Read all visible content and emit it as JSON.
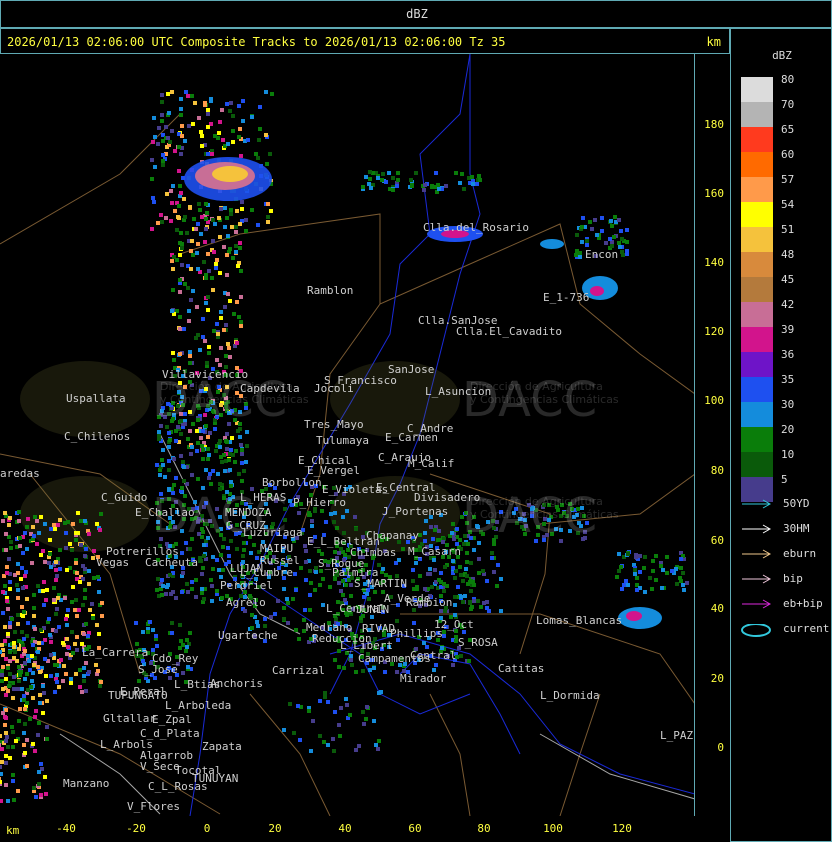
{
  "window_title": "dBZ",
  "header": {
    "text": "2026/01/13 02:06:00 UTC Composite Tracks to 2026/01/13 02:06:00 Tz 35",
    "unit": "km"
  },
  "axes": {
    "x_label": "km",
    "x_ticks": [
      "-40",
      "-20",
      "0",
      "20",
      "40",
      "60",
      "80",
      "100",
      "120"
    ],
    "y_ticks": [
      "180",
      "160",
      "140",
      "120",
      "100",
      "80",
      "60",
      "40",
      "20",
      "0"
    ]
  },
  "legend": {
    "title": "dBZ",
    "levels": [
      {
        "label": "80",
        "color": "#dcdcdc"
      },
      {
        "label": "70",
        "color": "#b4b4b4"
      },
      {
        "label": "65",
        "color": "#ff3a1e"
      },
      {
        "label": "60",
        "color": "#ff6a00"
      },
      {
        "label": "57",
        "color": "#ff9a4a"
      },
      {
        "label": "54",
        "color": "#ffff00"
      },
      {
        "label": "51",
        "color": "#f5c23c"
      },
      {
        "label": "48",
        "color": "#d88a3c"
      },
      {
        "label": "45",
        "color": "#b47a3c"
      },
      {
        "label": "42",
        "color": "#c86e96"
      },
      {
        "label": "39",
        "color": "#d2148c"
      },
      {
        "label": "36",
        "color": "#6e14c8"
      },
      {
        "label": "35",
        "color": "#1e50f0"
      },
      {
        "label": "30",
        "color": "#148cdc"
      },
      {
        "label": "20",
        "color": "#0a7d0a"
      },
      {
        "label": "10",
        "color": "#0a5a0a"
      },
      {
        "label": "5",
        "color": "#463c8c"
      }
    ],
    "tracks": [
      {
        "label": "50YD",
        "color": "#32c8dc",
        "type": "arrow"
      },
      {
        "label": "30HM",
        "color": "#ffffff",
        "type": "arrow"
      },
      {
        "label": "eburn",
        "color": "#f0c88c",
        "type": "arrow"
      },
      {
        "label": "bip",
        "color": "#f0c8dc",
        "type": "arrow"
      },
      {
        "label": "eb+bip",
        "color": "#dc28dc",
        "type": "arrow"
      },
      {
        "label": "current",
        "color": "#32c8dc",
        "type": "ellipse"
      }
    ]
  },
  "watermark": {
    "brand": "DACC",
    "line1": "Dirección de Agricultura",
    "line2": "y Contingencias Climáticas"
  },
  "places": [
    {
      "name": "Clla.del_Rosario"
    },
    {
      "name": "Encon"
    },
    {
      "name": "E_1-736"
    },
    {
      "name": "Ramblon"
    },
    {
      "name": "Clla.SanJose"
    },
    {
      "name": "Clla.El_Cavadito"
    },
    {
      "name": "Villavicencio"
    },
    {
      "name": "Capdevila"
    },
    {
      "name": "S_Francisco"
    },
    {
      "name": "SanJose"
    },
    {
      "name": "L_Asuncion"
    },
    {
      "name": "Uspallata"
    },
    {
      "name": "Jocoli"
    },
    {
      "name": "Tres_Mayo"
    },
    {
      "name": "Tulumaya"
    },
    {
      "name": "C_Andre"
    },
    {
      "name": "E_Carmen"
    },
    {
      "name": "C_Chilenos"
    },
    {
      "name": "E_Chical"
    },
    {
      "name": "E_Vergel"
    },
    {
      "name": "C_Araujo"
    },
    {
      "name": "M_Calif"
    },
    {
      "name": "aredas"
    },
    {
      "name": "Borbollon"
    },
    {
      "name": "E_Violetas"
    },
    {
      "name": "E_Central"
    },
    {
      "name": "Divisadero"
    },
    {
      "name": "C_Guido"
    },
    {
      "name": "L_HERAS"
    },
    {
      "name": "P_Hierro"
    },
    {
      "name": "E_Challao"
    },
    {
      "name": "MENDOZA"
    },
    {
      "name": "J_Portenas"
    },
    {
      "name": "G_CRUZ"
    },
    {
      "name": "Luzuriaga"
    },
    {
      "name": "Chapanay"
    },
    {
      "name": "E_L_Beltran"
    },
    {
      "name": "Chimbas"
    },
    {
      "name": "M_Casarn"
    },
    {
      "name": "Potrerillos"
    },
    {
      "name": "MAIPU"
    },
    {
      "name": "Russel"
    },
    {
      "name": "Vegas"
    },
    {
      "name": "Cacheuta"
    },
    {
      "name": "LUJAN"
    },
    {
      "name": "L_Cumbre"
    },
    {
      "name": "S_Roque"
    },
    {
      "name": "Palmira"
    },
    {
      "name": "Perdriel"
    },
    {
      "name": "S_MARTIN"
    },
    {
      "name": "A_Verde"
    },
    {
      "name": "Rambion"
    },
    {
      "name": "Agrelo"
    },
    {
      "name": "L_Central"
    },
    {
      "name": "JUNIN"
    },
    {
      "name": "Lomas_Blancas"
    },
    {
      "name": "Ugarteche"
    },
    {
      "name": "Medrano"
    },
    {
      "name": "RIVAD"
    },
    {
      "name": "Phillips"
    },
    {
      "name": "12_Oct"
    },
    {
      "name": "Reduccion"
    },
    {
      "name": "S_ROSA"
    },
    {
      "name": "La_Carrera"
    },
    {
      "name": "Cdo_Rey"
    },
    {
      "name": "L_Libert"
    },
    {
      "name": "Campamentos"
    },
    {
      "name": "Central"
    },
    {
      "name": "S_Jose"
    },
    {
      "name": "Carrizal"
    },
    {
      "name": "Catitas"
    },
    {
      "name": "E_Peral"
    },
    {
      "name": "L_Btias"
    },
    {
      "name": "Anchoris"
    },
    {
      "name": "Mirador"
    },
    {
      "name": "TUPUNGATO"
    },
    {
      "name": "L_Dormida"
    },
    {
      "name": "L_Arboleda"
    },
    {
      "name": "Gltallar"
    },
    {
      "name": "E_Zpal"
    },
    {
      "name": "C_d_Plata"
    },
    {
      "name": "L_PAZ"
    },
    {
      "name": "L_Arbols"
    },
    {
      "name": "Zapata"
    },
    {
      "name": "Algarrob"
    },
    {
      "name": "V_Seco"
    },
    {
      "name": "Tocotal"
    },
    {
      "name": "TUNUYAN"
    },
    {
      "name": "Manzano"
    },
    {
      "name": "C_L_Rosas"
    },
    {
      "name": "V_Flores"
    }
  ]
}
